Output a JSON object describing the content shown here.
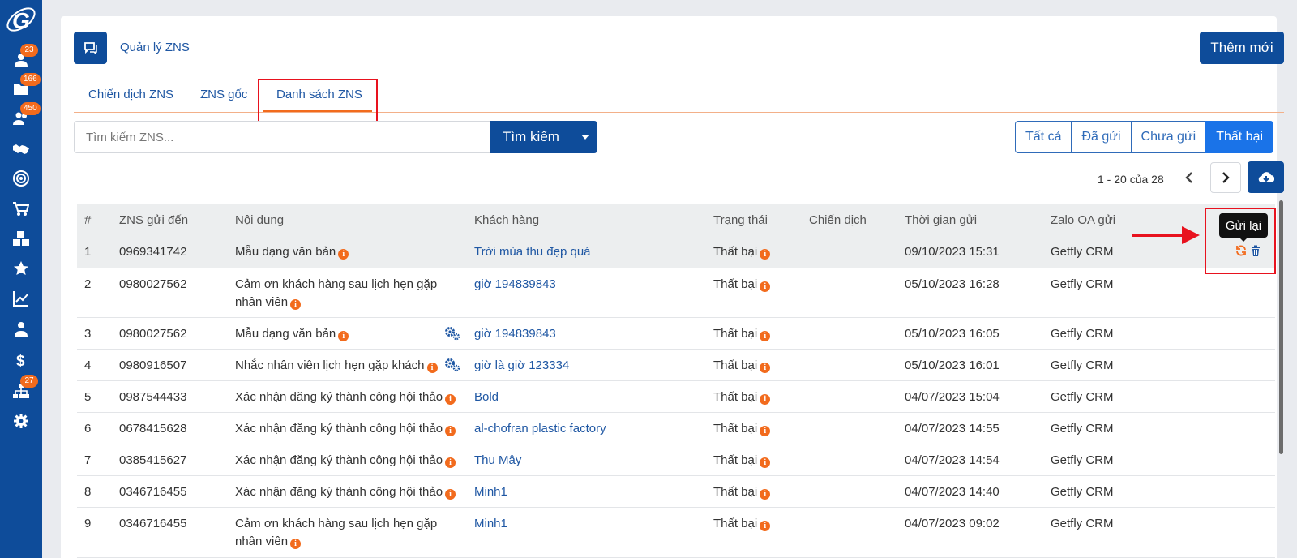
{
  "sidebar": {
    "items": [
      {
        "icon": "user-icon",
        "badge": "23"
      },
      {
        "icon": "folder-icon",
        "badge": "166"
      },
      {
        "icon": "users-icon",
        "badge": "450"
      },
      {
        "icon": "handshake-icon",
        "badge": null
      },
      {
        "icon": "target-icon",
        "badge": null
      },
      {
        "icon": "cart-icon",
        "badge": null
      },
      {
        "icon": "boxes-icon",
        "badge": null
      },
      {
        "icon": "star-icon",
        "badge": null
      },
      {
        "icon": "chart-line-icon",
        "badge": null
      },
      {
        "icon": "user-tie-icon",
        "badge": null
      },
      {
        "icon": "dollar-icon",
        "badge": null
      },
      {
        "icon": "sitemap-icon",
        "badge": "27"
      },
      {
        "icon": "gear-icon",
        "badge": null
      }
    ]
  },
  "header": {
    "title": "Quản lý ZNS",
    "add_button": "Thêm mới"
  },
  "tabs": [
    {
      "label": "Chiến dịch ZNS",
      "active": false
    },
    {
      "label": "ZNS gốc",
      "active": false
    },
    {
      "label": "Danh sách ZNS",
      "active": true
    }
  ],
  "search": {
    "placeholder": "Tìm kiếm ZNS...",
    "button": "Tìm kiếm"
  },
  "filters": {
    "all": "Tất cả",
    "sent": "Đã gửi",
    "unsent": "Chưa gửi",
    "failed": "Thất bại",
    "active": "failed"
  },
  "pagination": {
    "text": "1 - 20 của 28"
  },
  "table": {
    "headers": {
      "index": "#",
      "phone": "ZNS gửi đến",
      "content": "Nội dung",
      "customer": "Khách hàng",
      "status": "Trạng thái",
      "campaign": "Chiến dịch",
      "time": "Thời gian gửi",
      "oa": "Zalo OA gửi"
    },
    "rows": [
      {
        "index": "1",
        "phone": "0969341742",
        "content": "Mẫu dạng văn bản",
        "customer": "Trời mùa thu đẹp quá",
        "status": "Thất bại",
        "campaign": "",
        "time": "09/10/2023 15:31",
        "oa": "Getfly CRM"
      },
      {
        "index": "2",
        "phone": "0980027562",
        "content": "Cảm ơn khách hàng sau lịch hẹn gặp nhân viên",
        "customer": "giờ 194839843",
        "status": "Thất bại",
        "campaign": "",
        "time": "05/10/2023 16:28",
        "oa": "Getfly CRM"
      },
      {
        "index": "3",
        "phone": "0980027562",
        "content": "Mẫu dạng văn bản",
        "customer": "giờ 194839843",
        "status": "Thất bại",
        "campaign": "",
        "time": "05/10/2023 16:05",
        "oa": "Getfly CRM"
      },
      {
        "index": "4",
        "phone": "0980916507",
        "content": "Nhắc nhân viên lịch hẹn gặp khách",
        "customer": "giờ là giờ 123334",
        "status": "Thất bại",
        "campaign": "",
        "time": "05/10/2023 16:01",
        "oa": "Getfly CRM"
      },
      {
        "index": "5",
        "phone": "0987544433",
        "content": "Xác nhận đăng ký thành công hội thảo",
        "customer": "Bold",
        "status": "Thất bại",
        "campaign": "",
        "time": "04/07/2023 15:04",
        "oa": "Getfly CRM"
      },
      {
        "index": "6",
        "phone": "0678415628",
        "content": "Xác nhận đăng ký thành công hội thảo",
        "customer": "al-chofran plastic factory",
        "status": "Thất bại",
        "campaign": "",
        "time": "04/07/2023 14:55",
        "oa": "Getfly CRM"
      },
      {
        "index": "7",
        "phone": "0385415627",
        "content": "Xác nhận đăng ký thành công hội thảo",
        "customer": "Thu Mây",
        "status": "Thất bại",
        "campaign": "",
        "time": "04/07/2023 14:54",
        "oa": "Getfly CRM"
      },
      {
        "index": "8",
        "phone": "0346716455",
        "content": "Xác nhận đăng ký thành công hội thảo",
        "customer": "Minh1",
        "status": "Thất bại",
        "campaign": "",
        "time": "04/07/2023 14:40",
        "oa": "Getfly CRM"
      },
      {
        "index": "9",
        "phone": "0346716455",
        "content": "Cảm ơn khách hàng sau lịch hẹn gặp nhân viên",
        "customer": "Minh1",
        "status": "Thất bại",
        "campaign": "",
        "time": "04/07/2023 09:02",
        "oa": "Getfly CRM"
      }
    ]
  },
  "tooltip": {
    "resend": "Gửi lại"
  },
  "colors": {
    "primary": "#0e4c9a",
    "accent": "#f26b1d",
    "annotation": "#e8121e"
  }
}
